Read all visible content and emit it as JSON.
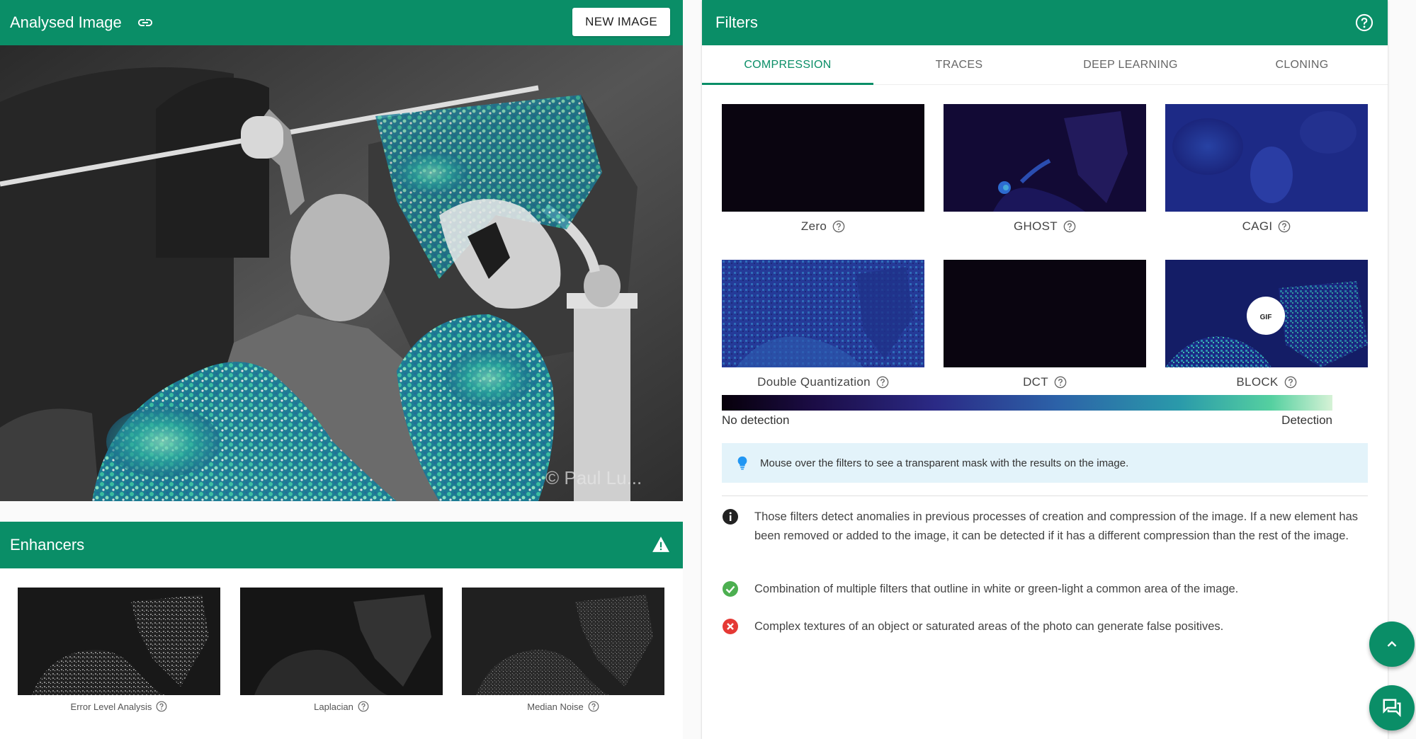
{
  "analysed_image": {
    "title": "Analysed Image",
    "new_image_label": "NEW IMAGE",
    "watermark": "© Paul Lu..."
  },
  "enhancers": {
    "title": "Enhancers",
    "items": [
      {
        "label": "Error Level Analysis"
      },
      {
        "label": "Laplacian"
      },
      {
        "label": "Median Noise"
      }
    ]
  },
  "filters": {
    "title": "Filters",
    "tabs": [
      "COMPRESSION",
      "TRACES",
      "DEEP LEARNING",
      "CLONING"
    ],
    "active_tab": "COMPRESSION",
    "items": [
      {
        "label": "Zero"
      },
      {
        "label": "GHOST"
      },
      {
        "label": "CAGI"
      },
      {
        "label": "Double Quantization"
      },
      {
        "label": "DCT"
      },
      {
        "label": "BLOCK",
        "badge": "GIF"
      }
    ],
    "scale": {
      "low_label": "No detection",
      "high_label": "Detection"
    },
    "hint": "Mouse over the filters to see a transparent mask with the results on the image.",
    "notes": [
      {
        "icon": "info-icon",
        "text": "Those filters detect anomalies in previous processes of creation and compression of the image. If a new element has been removed or added to the image, it can be detected if it has a different compression than the rest of the image."
      },
      {
        "icon": "check-circle-icon",
        "text": "Combination of multiple filters that outline in white or green-light a common area of the image."
      },
      {
        "icon": "error-circle-icon",
        "text": "Complex textures of an object or saturated areas of the photo can generate false positives."
      }
    ]
  },
  "colors": {
    "brand": "#0a8e67",
    "hint_bg": "#e3f3fa",
    "success": "#4caf50",
    "error": "#e53935"
  }
}
